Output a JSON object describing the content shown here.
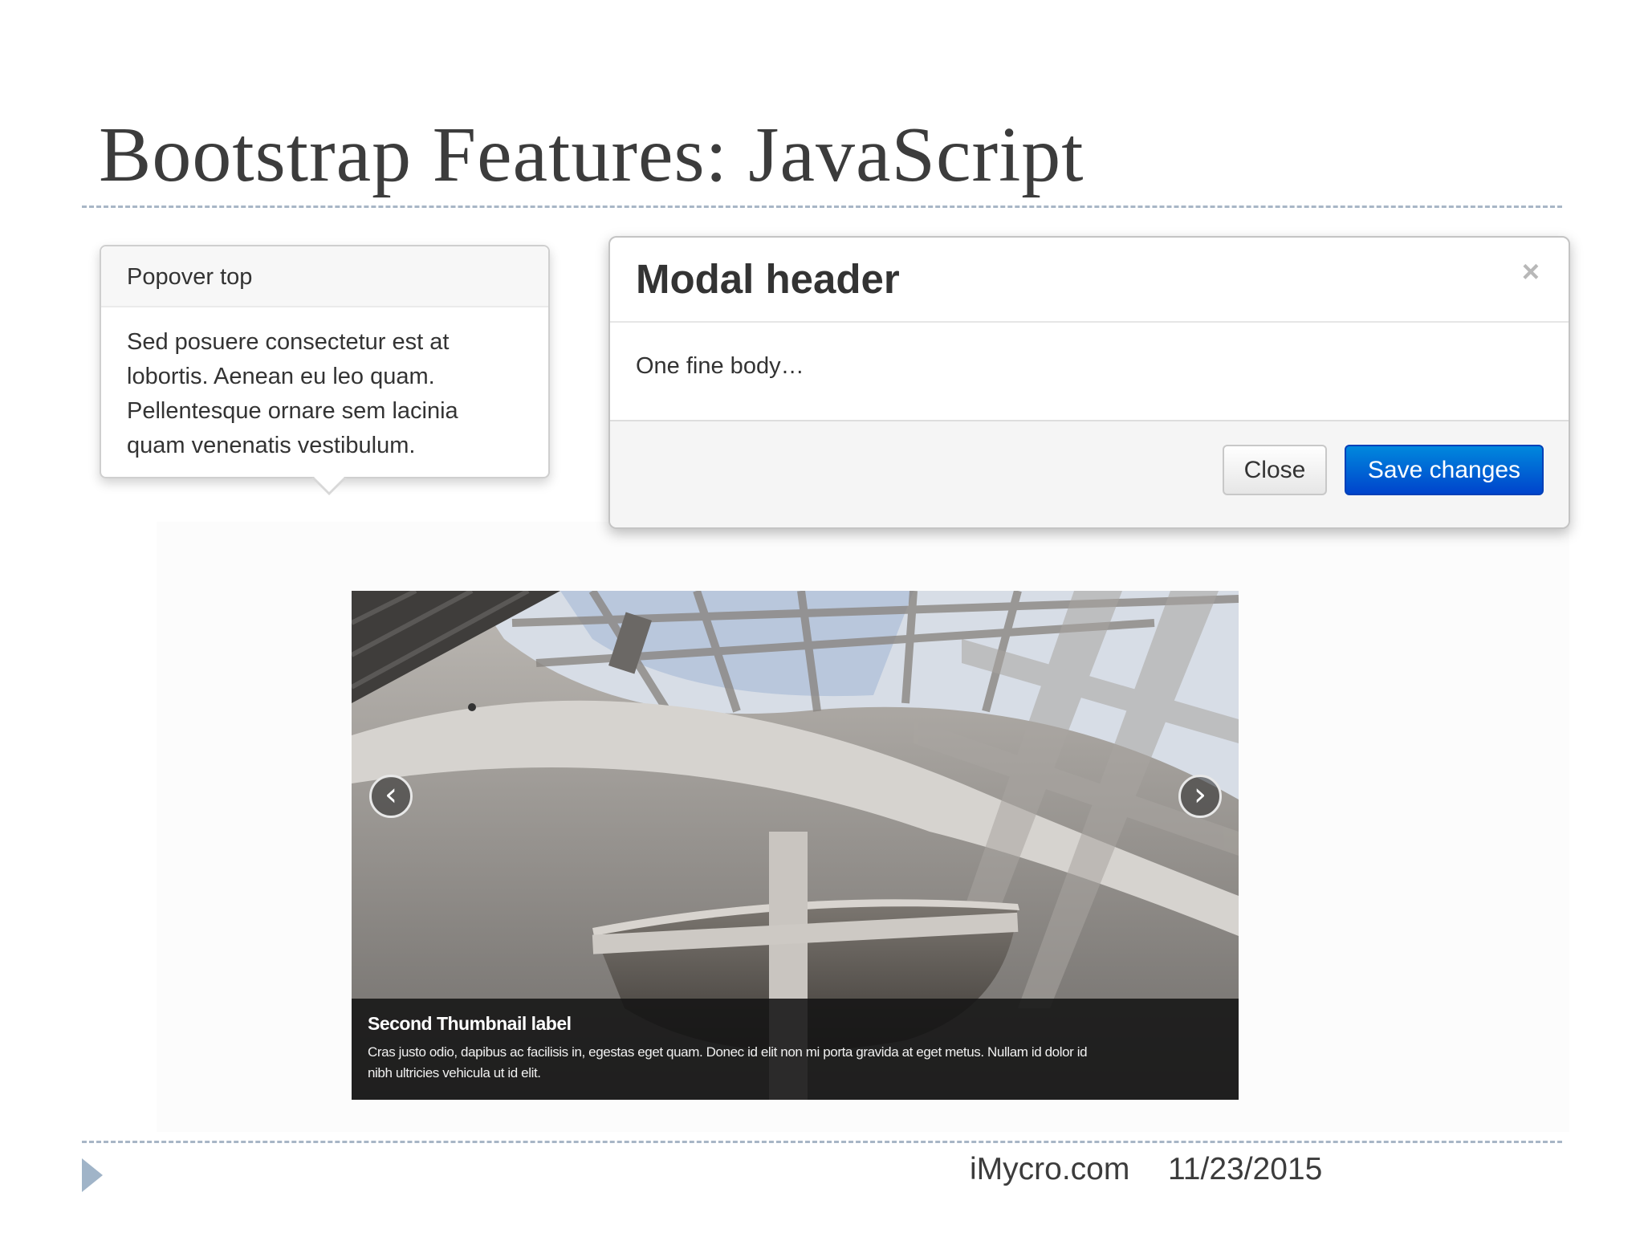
{
  "slide": {
    "title": "Bootstrap Features: JavaScript"
  },
  "popover": {
    "title": "Popover top",
    "body_lines": [
      "Sed posuere consectetur est at",
      "lobortis. Aenean eu leo quam.",
      "Pellentesque ornare sem lacinia",
      "quam venenatis vestibulum."
    ]
  },
  "modal": {
    "header": "Modal header",
    "close_glyph": "×",
    "body": "One fine body…",
    "buttons": {
      "close_label": "Close",
      "save_label": "Save changes"
    },
    "colors": {
      "primary": "#0055cc"
    }
  },
  "carousel": {
    "prev_glyph": "‹",
    "next_glyph": "›",
    "prev_icon": "chevron-left-icon",
    "next_icon": "chevron-right-icon",
    "caption_title": "Second Thumbnail label",
    "caption_lines": [
      "Cras justo odio, dapibus ac facilisis in, egestas eget quam. Donec id elit non mi porta gravida at eget metus. Nullam id dolor id",
      "nibh ultricies vehicula ut id elit."
    ]
  },
  "footer": {
    "site": "iMycro.com",
    "date": "11/23/2015",
    "marker_icon": "triangle-right-icon"
  }
}
